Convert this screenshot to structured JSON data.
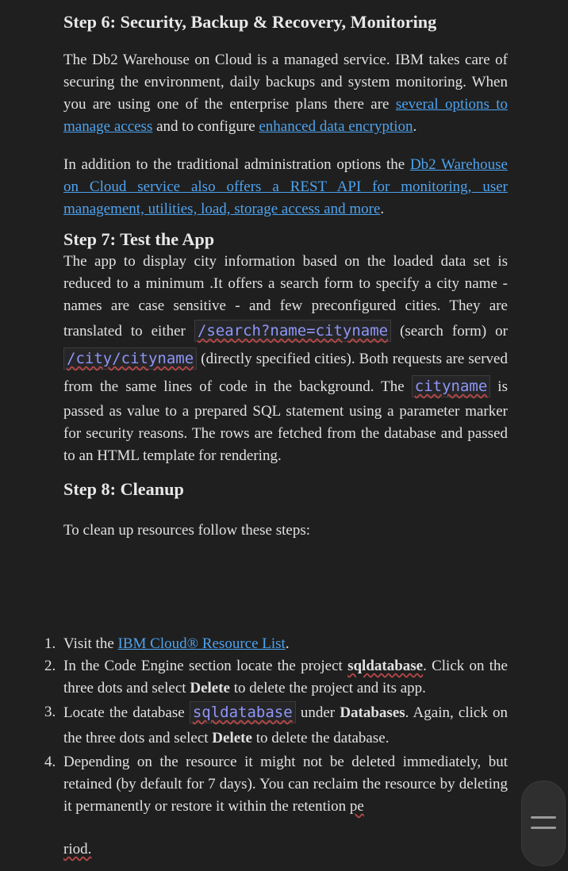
{
  "step6": {
    "heading": "Step 6: Security, Backup & Recovery, Monitoring",
    "p1_a": "The Db2 Warehouse on Cloud is a managed service. IBM takes care of securing the environment, daily backups and system monitoring. When you are using one of the enterprise plans there are ",
    "p1_link1": "several options to manage access",
    "p1_b": " and to configure ",
    "p1_link2": "enhanced data encryption",
    "p1_c": ".",
    "p2_a": "In addition to the traditional administration options the ",
    "p2_link": "Db2 Warehouse on Cloud service also offers a REST API for monitoring, user management, utilities, load, storage access and more",
    "p2_b": "."
  },
  "step7": {
    "heading": "Step 7: Test the App",
    "t1": "The app to display city information based on the loaded data set is reduced to a minimum .It offers a search form to specify a city name - names are case sensitive - and few preconfigured cities. They are translated to either ",
    "code1": "/search?name=cityname",
    "t2": " (search form) or ",
    "code2": "/city/cityname",
    "t3": " (directly specified cities). Both requests are served from the same lines of code in the background. The ",
    "code3": "cityname",
    "t4": " is passed as value to a prepared SQL statement using a parameter marker for security reasons. The rows are fetched from the database and passed to an HTML template for rendering."
  },
  "step8": {
    "heading": "Step 8: Cleanup",
    "intro": "To clean up resources follow these steps:",
    "items": [
      {
        "num": "1.",
        "a": "Visit the ",
        "link": "IBM Cloud® Resource List",
        "b": "."
      },
      {
        "num": "2.",
        "a": "In the Code Engine section locate the project ",
        "bold1": "sqldatabase",
        "b": ". Click on the three dots and select ",
        "bold2": "Delete",
        "c": " to delete the project and its app."
      },
      {
        "num": "3.",
        "a": "Locate the database ",
        "code": "sqldatabase",
        "b": " under ",
        "bold1": "Databases",
        "c": ". Again, click on the three dots and select ",
        "bold2": "Delete",
        "d": " to delete the database."
      },
      {
        "num": "4.",
        "a": "Depending on the resource it might not be deleted immediately, but retained (by default for 7 days). You can reclaim the resource by deleting it permanently or restore it within the retention ",
        "b": "pe"
      }
    ],
    "tail": "riod."
  }
}
